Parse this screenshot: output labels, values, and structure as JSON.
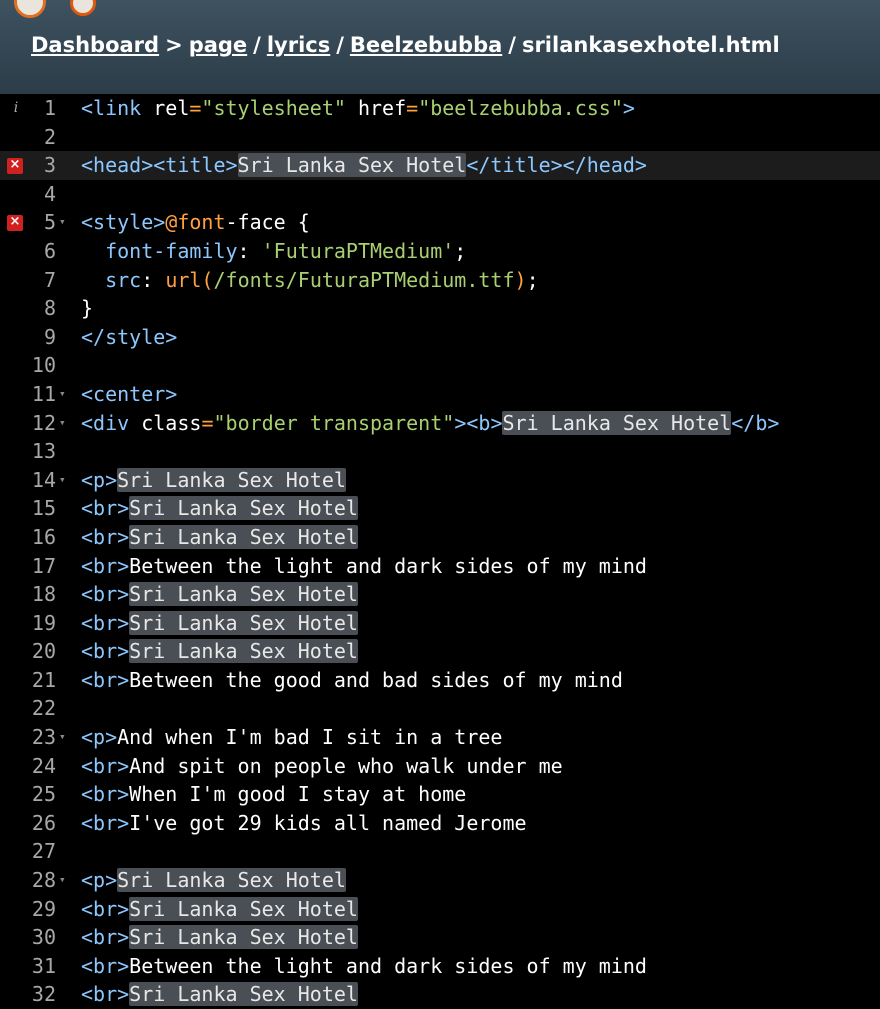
{
  "header": {
    "breadcrumb": [
      "Dashboard",
      "page",
      "lyrics",
      "Beelzebubba",
      "srilankasexhotel.html"
    ],
    "separators": [
      ">",
      "/",
      "/",
      "/"
    ]
  },
  "colors": {
    "tag": "#8cc8ff",
    "string": "#a8d070",
    "keyword": "#ffa040",
    "error": "#d02020"
  },
  "editor": {
    "lines": [
      {
        "n": "1",
        "mark": "info",
        "segs": [
          [
            "tag",
            "<link "
          ],
          [
            "attr",
            "rel"
          ],
          [
            "eq",
            "="
          ],
          [
            "str",
            "\"stylesheet\""
          ],
          [
            "attr",
            " href"
          ],
          [
            "eq",
            "="
          ],
          [
            "str",
            "\"beelzebubba.css\""
          ],
          [
            "tag",
            ">"
          ]
        ]
      },
      {
        "n": "2",
        "segs": []
      },
      {
        "n": "3",
        "mark": "error",
        "active": true,
        "segs": [
          [
            "tag",
            "<head><title>"
          ],
          [
            "hl",
            "Sri Lanka Sex Hotel"
          ],
          [
            "tag",
            "</title></head>"
          ]
        ]
      },
      {
        "n": "4",
        "segs": []
      },
      {
        "n": "5",
        "mark": "error",
        "fold": true,
        "segs": [
          [
            "tag",
            "<style>"
          ],
          [
            "kw",
            "@font"
          ],
          [
            "attr",
            "-face {"
          ]
        ]
      },
      {
        "n": "6",
        "segs": [
          [
            "attr",
            "  "
          ],
          [
            "prop",
            "font-family"
          ],
          [
            "attr",
            ": "
          ],
          [
            "str",
            "'FuturaPTMedium'"
          ],
          [
            "attr",
            ";"
          ]
        ]
      },
      {
        "n": "7",
        "segs": [
          [
            "attr",
            "  "
          ],
          [
            "prop",
            "src"
          ],
          [
            "attr",
            ": "
          ],
          [
            "kw",
            "url("
          ],
          [
            "str",
            "/fonts/FuturaPTMedium.ttf"
          ],
          [
            "kw",
            ")"
          ],
          [
            "attr",
            ";"
          ]
        ]
      },
      {
        "n": "8",
        "segs": [
          [
            "attr",
            "}"
          ]
        ]
      },
      {
        "n": "9",
        "segs": [
          [
            "tag",
            "</style>"
          ]
        ]
      },
      {
        "n": "10",
        "segs": []
      },
      {
        "n": "11",
        "fold": true,
        "segs": [
          [
            "tag",
            "<center>"
          ]
        ]
      },
      {
        "n": "12",
        "fold": true,
        "segs": [
          [
            "tag",
            "<div "
          ],
          [
            "attr",
            "class"
          ],
          [
            "eq",
            "="
          ],
          [
            "str",
            "\"border transparent\""
          ],
          [
            "tag",
            ">"
          ],
          [
            "tag",
            "<b>"
          ],
          [
            "hl",
            "Sri Lanka Sex Hotel"
          ],
          [
            "tag",
            "</b>"
          ]
        ]
      },
      {
        "n": "13",
        "segs": []
      },
      {
        "n": "14",
        "fold": true,
        "segs": [
          [
            "tag",
            "<p>"
          ],
          [
            "hl",
            "Sri Lanka Sex Hotel"
          ]
        ]
      },
      {
        "n": "15",
        "segs": [
          [
            "tag",
            "<br>"
          ],
          [
            "hl",
            "Sri Lanka Sex Hotel"
          ]
        ]
      },
      {
        "n": "16",
        "segs": [
          [
            "tag",
            "<br>"
          ],
          [
            "hl",
            "Sri Lanka Sex Hotel"
          ]
        ]
      },
      {
        "n": "17",
        "segs": [
          [
            "tag",
            "<br>"
          ],
          [
            "attr",
            "Between the light and dark sides of my mind"
          ]
        ]
      },
      {
        "n": "18",
        "segs": [
          [
            "tag",
            "<br>"
          ],
          [
            "hl",
            "Sri Lanka Sex Hotel"
          ]
        ]
      },
      {
        "n": "19",
        "segs": [
          [
            "tag",
            "<br>"
          ],
          [
            "hl",
            "Sri Lanka Sex Hotel"
          ]
        ]
      },
      {
        "n": "20",
        "segs": [
          [
            "tag",
            "<br>"
          ],
          [
            "hl",
            "Sri Lanka Sex Hotel"
          ]
        ]
      },
      {
        "n": "21",
        "segs": [
          [
            "tag",
            "<br>"
          ],
          [
            "attr",
            "Between the good and bad sides of my mind"
          ]
        ]
      },
      {
        "n": "22",
        "segs": []
      },
      {
        "n": "23",
        "fold": true,
        "segs": [
          [
            "tag",
            "<p>"
          ],
          [
            "attr",
            "And when I'm bad I sit in a tree"
          ]
        ]
      },
      {
        "n": "24",
        "segs": [
          [
            "tag",
            "<br>"
          ],
          [
            "attr",
            "And spit on people who walk under me"
          ]
        ]
      },
      {
        "n": "25",
        "segs": [
          [
            "tag",
            "<br>"
          ],
          [
            "attr",
            "When I'm good I stay at home"
          ]
        ]
      },
      {
        "n": "26",
        "segs": [
          [
            "tag",
            "<br>"
          ],
          [
            "attr",
            "I've got 29 kids all named Jerome"
          ]
        ]
      },
      {
        "n": "27",
        "segs": []
      },
      {
        "n": "28",
        "fold": true,
        "segs": [
          [
            "tag",
            "<p>"
          ],
          [
            "hl",
            "Sri Lanka Sex Hotel"
          ]
        ]
      },
      {
        "n": "29",
        "segs": [
          [
            "tag",
            "<br>"
          ],
          [
            "hl",
            "Sri Lanka Sex Hotel"
          ]
        ]
      },
      {
        "n": "30",
        "segs": [
          [
            "tag",
            "<br>"
          ],
          [
            "hl",
            "Sri Lanka Sex Hotel"
          ]
        ]
      },
      {
        "n": "31",
        "segs": [
          [
            "tag",
            "<br>"
          ],
          [
            "attr",
            "Between the light and dark sides of my mind"
          ]
        ]
      },
      {
        "n": "32",
        "segs": [
          [
            "tag",
            "<br>"
          ],
          [
            "hl",
            "Sri Lanka Sex Hotel"
          ]
        ]
      }
    ]
  }
}
